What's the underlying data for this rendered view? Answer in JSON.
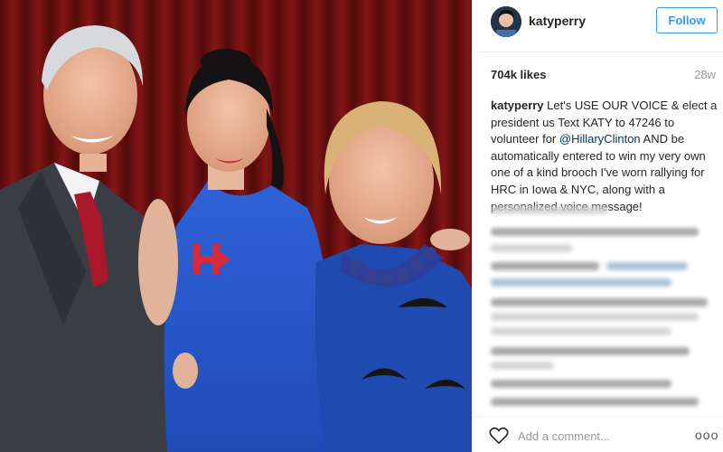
{
  "post": {
    "username": "katyperry",
    "follow_label": "Follow",
    "likes": "704k likes",
    "age": "28w",
    "caption": {
      "username": "katyperry",
      "part1": " Let's USE OUR VOICE & elect a president us Text KATY to 47246 to volunteer for ",
      "mention": "@HillaryClinton",
      "part2": " AND be automatically entered to win my very own one of a kind brooch I've worn rallying for HRC in Iowa & NYC, along with a personalized voice message!"
    },
    "comment_placeholder": "Add a comment...",
    "more_label": "ooo"
  },
  "icons": {
    "like": "heart-icon",
    "more": "more-options-icon"
  },
  "colors": {
    "accent": "#3897f0",
    "mention": "#003569",
    "text": "#262626",
    "muted": "#999999",
    "border": "#efefef"
  }
}
